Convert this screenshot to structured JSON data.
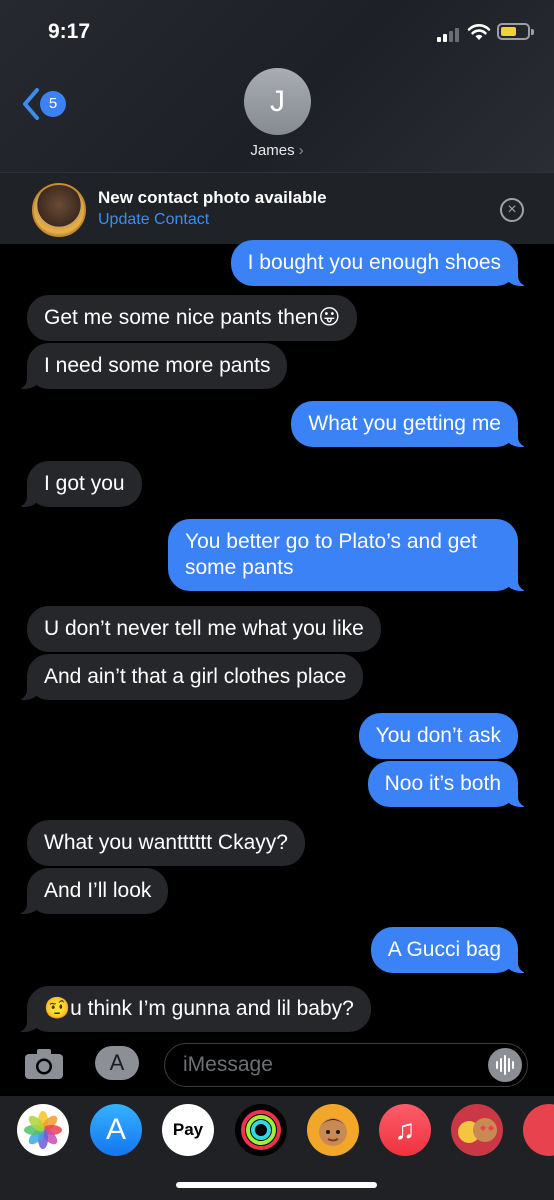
{
  "status_bar": {
    "time": "9:17"
  },
  "header": {
    "back_badge": "5",
    "avatar_initial": "J",
    "contact_name": "James",
    "contact_chevron": "›"
  },
  "banner": {
    "title": "New contact photo available",
    "link": "Update Contact",
    "close_glyph": "×"
  },
  "messages": [
    {
      "from": "me",
      "text": "I bought you enough shoes"
    },
    {
      "from": "them",
      "text": "Get me some nice pants then😛"
    },
    {
      "from": "them",
      "text": "I need some more pants"
    },
    {
      "from": "me",
      "text": "What you getting me"
    },
    {
      "from": "them",
      "text": "I got you"
    },
    {
      "from": "me",
      "text": "You better go to Plato’s and get some pants"
    },
    {
      "from": "them",
      "text": "U don’t never tell me what you like"
    },
    {
      "from": "them",
      "text": "And ain’t that a girl clothes place"
    },
    {
      "from": "me",
      "text": "You don’t ask"
    },
    {
      "from": "me",
      "text": "Noo it’s both"
    },
    {
      "from": "them",
      "text": "What you wantttttt Ckayy?"
    },
    {
      "from": "them",
      "text": "And I’ll look"
    },
    {
      "from": "me",
      "text": "A Gucci bag"
    },
    {
      "from": "them",
      "text": "🤨u think I’m gunna and lil baby?"
    }
  ],
  "compose": {
    "placeholder": "iMessage",
    "appstore_glyph": "A"
  },
  "app_drawer": {
    "apple_pay_label": "Pay",
    "app_store_glyph": "A",
    "music_glyph": "♫"
  },
  "colors": {
    "sent_bubble": "#3a82f6",
    "received_bubble": "#26272b",
    "link": "#3c8df0"
  }
}
